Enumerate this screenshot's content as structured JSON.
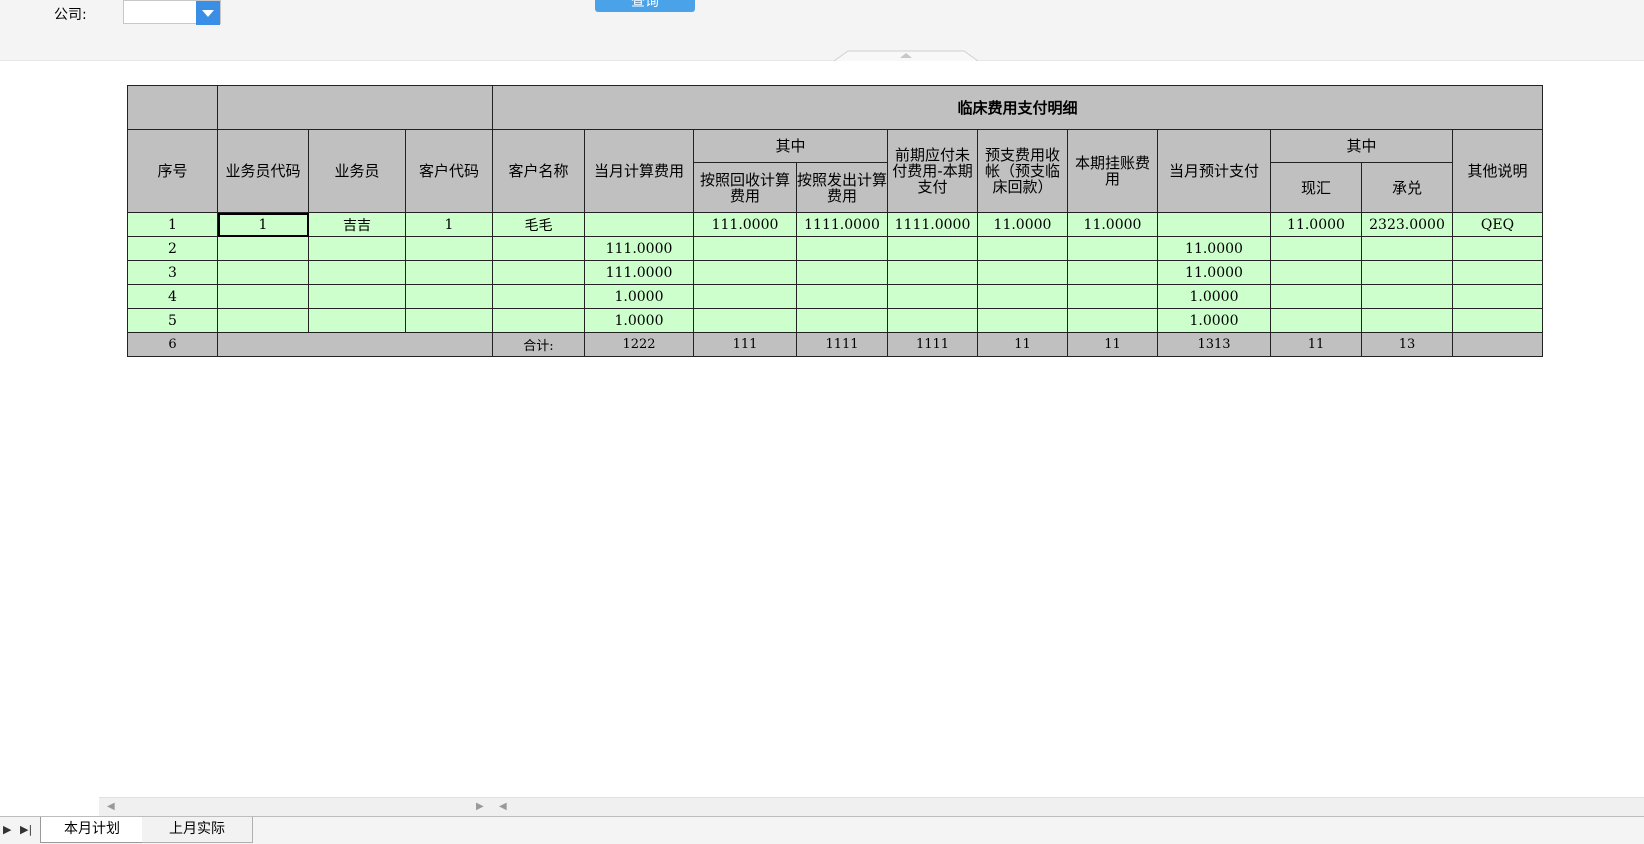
{
  "filter": {
    "company_label": "公司:",
    "company_value": "",
    "query_label": "查询"
  },
  "table": {
    "title": "临床费用支付明细",
    "headers": {
      "seq": "序号",
      "staff_code": "业务员代码",
      "staff": "业务员",
      "cust_code": "客户代码",
      "cust_name": "客户名称",
      "month_calc": "当月计算费用",
      "among1": "其中",
      "by_recovery": "按照回收计算费用",
      "by_shipment": "按照发出计算费用",
      "prior_unpaid": "前期应付未付费用-本期支付",
      "prepaid": "预支费用收帐（预支临床回款）",
      "pending": "本期挂账费用",
      "month_est": "当月预计支付",
      "among2": "其中",
      "cash": "现汇",
      "accept": "承兑",
      "notes": "其他说明"
    },
    "rows": [
      {
        "seq": "1",
        "staff_code": "1",
        "staff": "吉吉",
        "cust_code": "1",
        "cust_name": "毛毛",
        "month_calc": "",
        "by_recovery": "111.0000",
        "by_shipment": "1111.0000",
        "prior_unpaid": "1111.0000",
        "prepaid": "11.0000",
        "pending": "11.0000",
        "month_est": "",
        "cash": "11.0000",
        "accept": "2323.0000",
        "notes": "QEQ"
      },
      {
        "seq": "2",
        "staff_code": "",
        "staff": "",
        "cust_code": "",
        "cust_name": "",
        "month_calc": "111.0000",
        "by_recovery": "",
        "by_shipment": "",
        "prior_unpaid": "",
        "prepaid": "",
        "pending": "",
        "month_est": "11.0000",
        "cash": "",
        "accept": "",
        "notes": ""
      },
      {
        "seq": "3",
        "staff_code": "",
        "staff": "",
        "cust_code": "",
        "cust_name": "",
        "month_calc": "111.0000",
        "by_recovery": "",
        "by_shipment": "",
        "prior_unpaid": "",
        "prepaid": "",
        "pending": "",
        "month_est": "11.0000",
        "cash": "",
        "accept": "",
        "notes": ""
      },
      {
        "seq": "4",
        "staff_code": "",
        "staff": "",
        "cust_code": "",
        "cust_name": "",
        "month_calc": "1.0000",
        "by_recovery": "",
        "by_shipment": "",
        "prior_unpaid": "",
        "prepaid": "",
        "pending": "",
        "month_est": "1.0000",
        "cash": "",
        "accept": "",
        "notes": ""
      },
      {
        "seq": "5",
        "staff_code": "",
        "staff": "",
        "cust_code": "",
        "cust_name": "",
        "month_calc": "1.0000",
        "by_recovery": "",
        "by_shipment": "",
        "prior_unpaid": "",
        "prepaid": "",
        "pending": "",
        "month_est": "1.0000",
        "cash": "",
        "accept": "",
        "notes": ""
      }
    ],
    "total": {
      "seq": "6",
      "label": "合计:",
      "month_calc": "1222",
      "by_recovery": "111",
      "by_shipment": "1111",
      "prior_unpaid": "1111",
      "prepaid": "11",
      "pending": "11",
      "month_est": "1313",
      "cash": "11",
      "accept": "13",
      "notes": ""
    }
  },
  "sheets": {
    "tab1": "本月计划",
    "tab2": "上月实际"
  },
  "icons": {
    "dropdown": "chevron-down-icon",
    "scroll_left": "scroll-left-icon",
    "scroll_right": "scroll-right-icon",
    "collapse": "collapse-up-icon"
  }
}
